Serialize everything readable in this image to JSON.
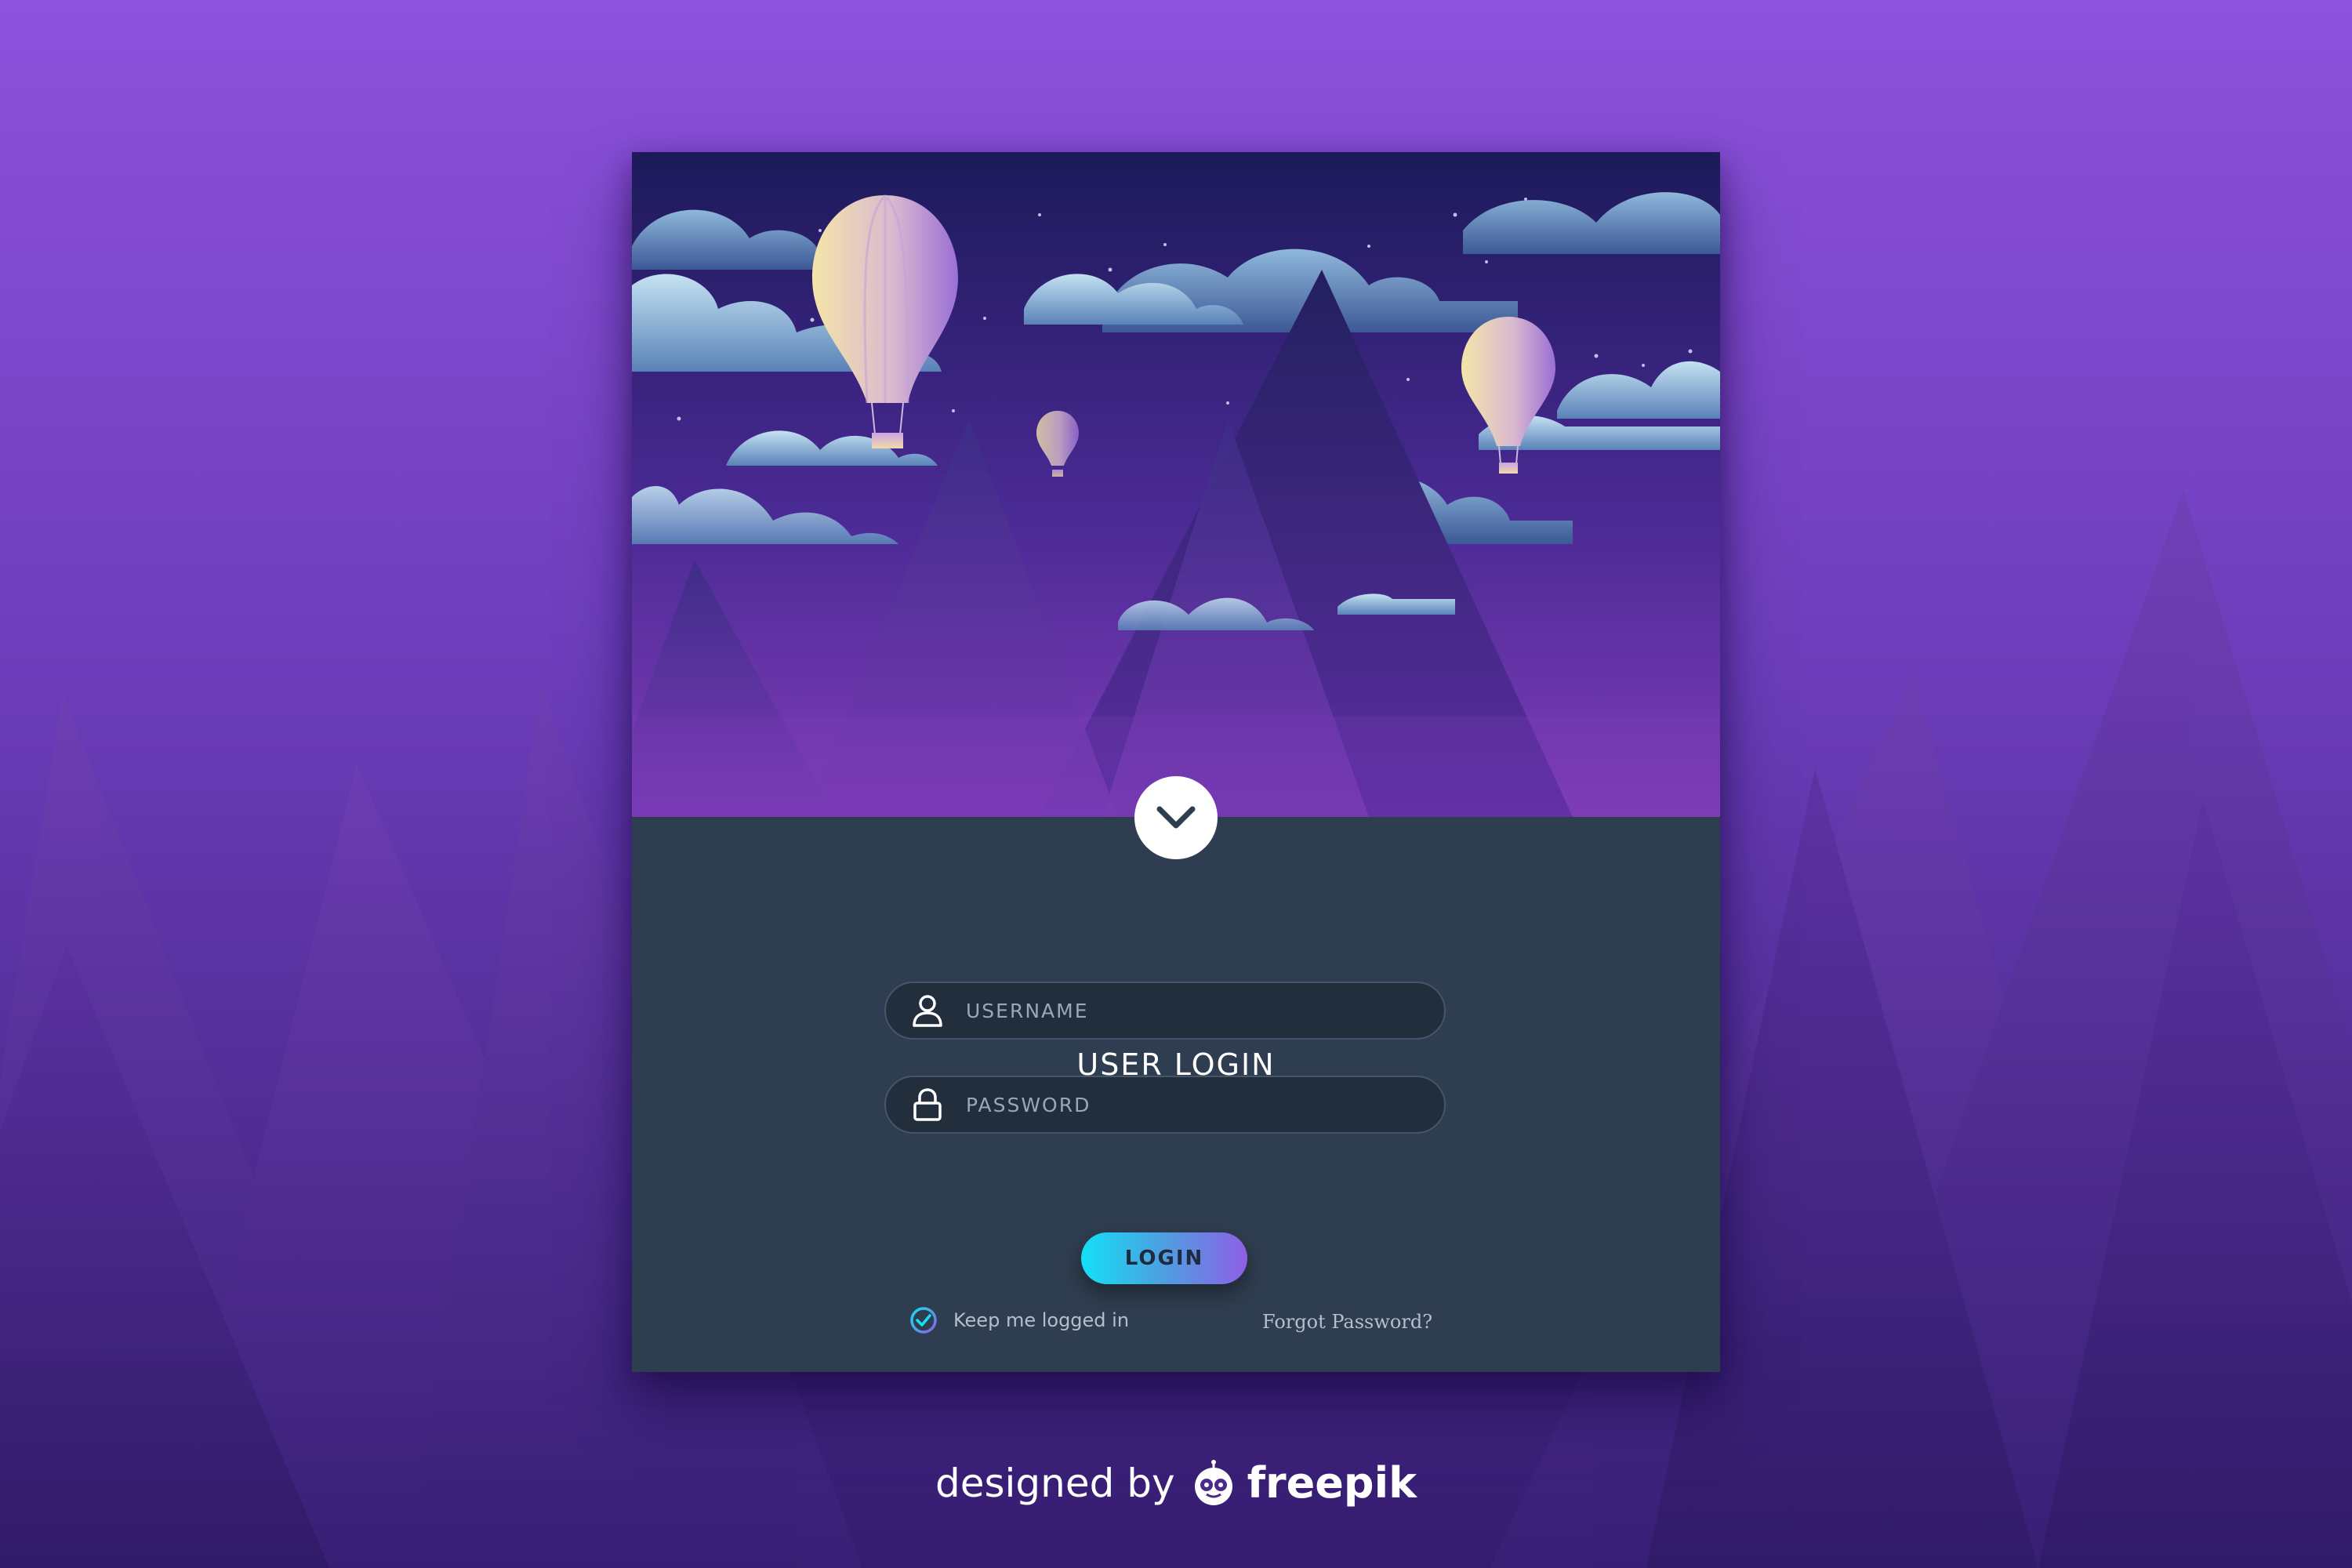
{
  "login": {
    "title": "USER LOGIN",
    "username_placeholder": "USERNAME",
    "password_placeholder": "PASSWORD",
    "remember_label": "Keep me logged in",
    "remember_checked": true,
    "forgot_label": "Forgot Password?",
    "login_label": "LOGIN"
  },
  "footer": {
    "designed_by": "designed by",
    "brand": "freepik"
  },
  "colors": {
    "background_top": "#8e52dc",
    "background_bottom": "#341c6e",
    "card_panel": "#2e3d4f",
    "input_fill": "#222e3b",
    "button_gradient_start": "#13e0f6",
    "button_gradient_end": "#8e5fe6"
  },
  "icons": {
    "chevron": "chevron-down-icon",
    "username": "user-icon",
    "password": "lock-icon",
    "remember": "check-circle-icon",
    "logo": "freepik-logo-icon"
  }
}
